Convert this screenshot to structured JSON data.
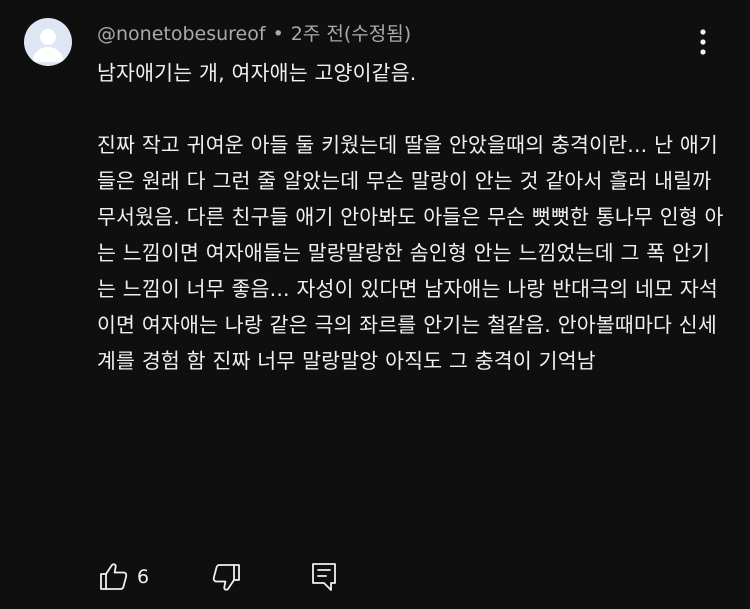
{
  "comment": {
    "author": "@nonetobesureof",
    "separator": "•",
    "time": "2주 전(수정됨)",
    "text": "남자애기는 개, 여자애는 고양이같음.\n\n진짜 작고 귀여운 아들 둘 키웠는데 딸을 안았을때의 충격이란... 난 애기들은 원래 다 그런 줄 알았는데 무슨 말랑이 안는 것 같아서 흘러 내릴까 무서웠음. 다른 친구들 애기 안아봐도 아들은 무슨 뻣뻣한 통나무 인형 아는 느낌이면 여자애들는 말랑말랑한 솜인형 안는 느낌었는데 그 폭 안기는 느낌이 너무 좋음... 자성이 있다면 남자애는 나랑 반대극의 네모 자석이면 여자애는 나랑 같은 극의 좌르를 안기는 철같음. 안아볼때마다 신세계를 경험 함 진짜 너무 말랑말앙 아직도 그 충격이 기억남",
    "like_count": "6"
  },
  "icons": {
    "avatar": "default-avatar-icon",
    "more": "vertical-dots-icon",
    "like": "thumb-up-icon",
    "dislike": "thumb-down-icon",
    "reply": "reply-comment-icon"
  },
  "colors": {
    "background": "#0f0f0f",
    "primary_text": "#f1f1f1",
    "secondary_text": "#aaaaaa",
    "avatar_bg": "#dfe6f3",
    "avatar_fg": "#ffffff"
  }
}
